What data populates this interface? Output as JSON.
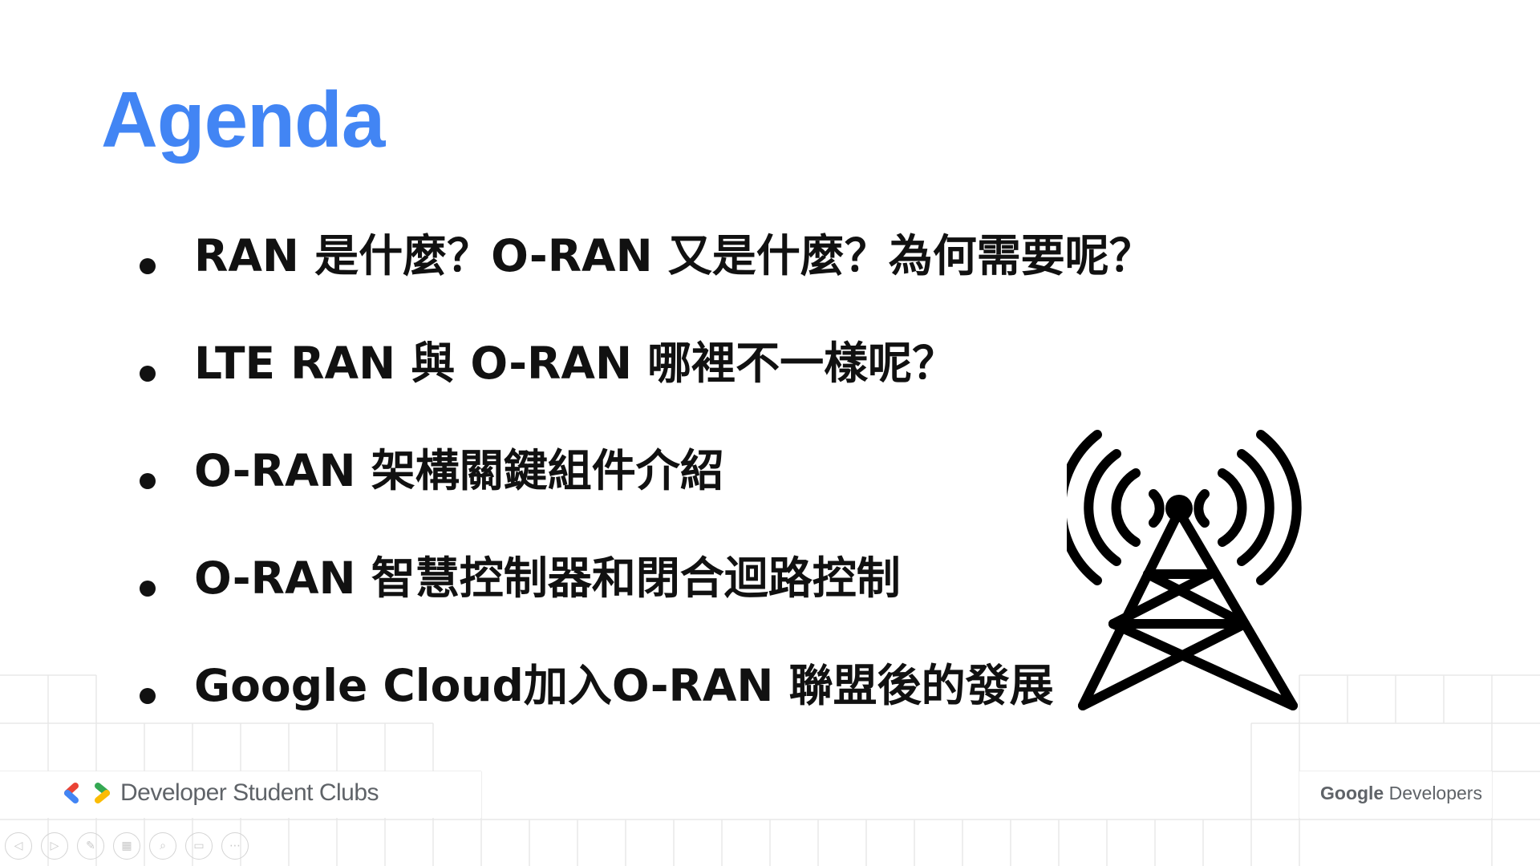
{
  "slide": {
    "title": "Agenda",
    "items": [
      {
        "text": "RAN 是什麼？O-RAN 又是什麼？為何需要呢？"
      },
      {
        "text": "LTE RAN 與 O-RAN 哪裡不一樣呢？"
      },
      {
        "text": "O-RAN 架構關鍵組件介紹"
      },
      {
        "text": "O-RAN 智慧控制器和閉合迴路控制"
      },
      {
        "text": "Google Cloud加入O-RAN 聯盟後的發展"
      }
    ],
    "illustration_icon": "cell-tower-icon"
  },
  "footer": {
    "left_brand": "Developer Student Clubs",
    "right_brand_google": "Google",
    "right_brand_developers": "Developers"
  },
  "controls": [
    {
      "name": "previous-slide-button",
      "glyph": "◁"
    },
    {
      "name": "next-slide-button",
      "glyph": "▷"
    },
    {
      "name": "pen-tool-button",
      "glyph": "✎"
    },
    {
      "name": "slides-overview-button",
      "glyph": "▦"
    },
    {
      "name": "zoom-button",
      "glyph": "⌕"
    },
    {
      "name": "subtitles-button",
      "glyph": "▭"
    },
    {
      "name": "more-options-button",
      "glyph": "⋯"
    }
  ],
  "colors": {
    "accent": "#4285F4",
    "text": "#111111",
    "grid": "#e8e8e8",
    "footer_text": "#5f6368"
  }
}
